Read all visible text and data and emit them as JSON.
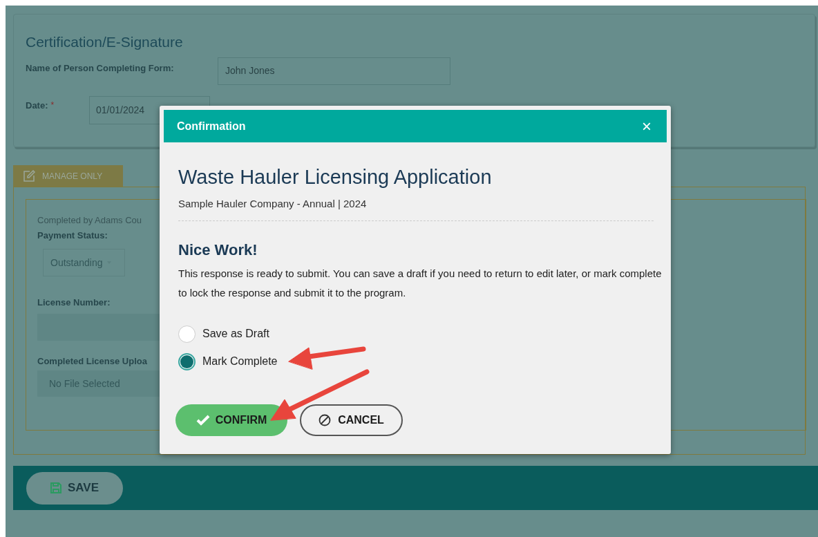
{
  "certification": {
    "title": "Certification/E-Signature",
    "name_label": "Name of Person Completing Form:",
    "name_value": "John Jones",
    "date_label": "Date:",
    "date_required": "*",
    "date_value": "01/01/2024"
  },
  "manage_only": {
    "tab_label": "MANAGE ONLY",
    "completed_by": "Completed by Adams Cou",
    "payment_status_label": "Payment Status:",
    "payment_status_value": "Outstanding",
    "license_number_label": "License Number:",
    "upload_label": "Completed License Uploa",
    "upload_value": "No File Selected"
  },
  "save_button": "SAVE",
  "dialog": {
    "header": "Confirmation",
    "close": "×",
    "title": "Waste Hauler Licensing Application",
    "subtitle": "Sample Hauler Company - Annual | 2024",
    "heading": "Nice Work!",
    "message": "This response is ready to submit. You can save a draft if you need to return to edit later, or mark complete to lock the response and submit it to the program.",
    "options": [
      {
        "label": "Save as Draft",
        "selected": false
      },
      {
        "label": "Mark Complete",
        "selected": true
      }
    ],
    "confirm": "CONFIRM",
    "cancel": "CANCEL"
  }
}
